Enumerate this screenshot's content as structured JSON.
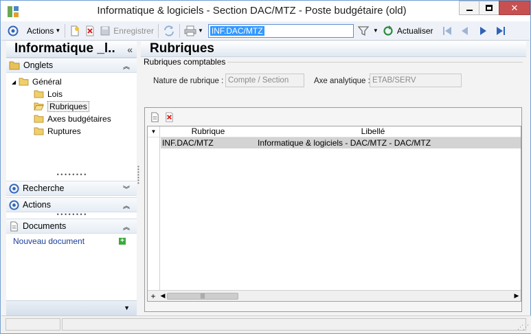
{
  "window": {
    "title": "Informatique & logiciels - Section DAC/MTZ -  Poste budgétaire (old)",
    "minimize": "—",
    "maximize": "□",
    "close": "✕"
  },
  "toolbar": {
    "actions_label": "Actions",
    "save_label": "Enregistrer",
    "search_value": "INF.DAC/MTZ",
    "refresh_label": "Actualiser"
  },
  "left_panel": {
    "header": "Informatique _l..",
    "collapse_glyph": "«",
    "onglets_label": "Onglets",
    "tree": {
      "root": "Général",
      "items": [
        "Lois",
        "Rubriques",
        "Axes budgétaires",
        "Ruptures"
      ]
    },
    "recherche_label": "Recherche",
    "actions_label": "Actions",
    "documents_label": "Documents",
    "new_document_label": "Nouveau document"
  },
  "main_panel": {
    "header": "Rubriques",
    "group_title": "Rubriques comptables",
    "nature_label": "Nature de rubrique :",
    "nature_value": "Compte / Section",
    "axe_label": "Axe analytique :",
    "axe_value": "ETAB/SERV",
    "grid": {
      "columns": [
        "Rubrique",
        "Libellé"
      ],
      "rows": [
        [
          "INF.DAC/MTZ",
          "Informatique & logiciels - DAC/MTZ - DAC/MTZ"
        ]
      ]
    }
  },
  "colors": {
    "accent": "#3399ff",
    "window_border": "#6f9ed1",
    "link": "#1a3d99",
    "close_button": "#c75050"
  }
}
